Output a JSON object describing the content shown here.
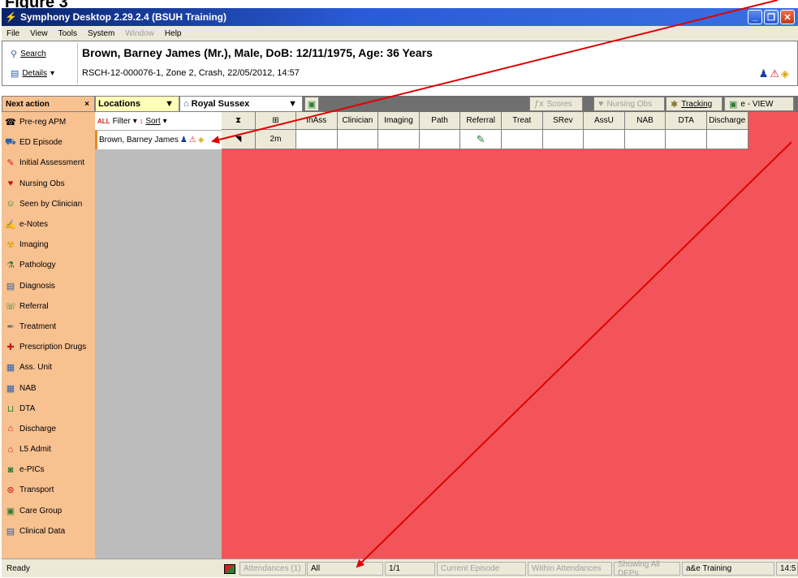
{
  "figure_label": "Figure 3",
  "window": {
    "title": "Symphony Desktop 2.29.2.4 (BSUH Training)",
    "buttons": {
      "minimize": "_",
      "restore": "❐",
      "close": "✕"
    }
  },
  "menu": [
    "File",
    "View",
    "Tools",
    "System",
    "Window",
    "Help"
  ],
  "patient": {
    "search_label": "Search",
    "details_label": "Details",
    "name_line": "Brown, Barney James (Mr.), Male, DoB: 12/11/1975, Age:  36 Years",
    "episode_line": "RSCH-12-000076-1, Zone 2, Crash, 22/05/2012, 14:57"
  },
  "toolbar": {
    "next_action": "Next action",
    "next_action_close": "×",
    "locations": "Locations",
    "site": "Royal Sussex",
    "scores": "Scores",
    "nursing_obs": "Nursing Obs",
    "tracking": "Tracking",
    "eview": "e - VIEW"
  },
  "sidebar": [
    {
      "label": "Pre-reg APM",
      "icon": "phone-icon"
    },
    {
      "label": "ED Episode",
      "icon": "ambulance-icon"
    },
    {
      "label": "Initial Assessment",
      "icon": "assessment-icon"
    },
    {
      "label": "Nursing Obs",
      "icon": "heart-icon"
    },
    {
      "label": "Seen by Clinician",
      "icon": "clinician-icon"
    },
    {
      "label": "e-Notes",
      "icon": "notes-icon"
    },
    {
      "label": "Imaging",
      "icon": "radiation-icon"
    },
    {
      "label": "Pathology",
      "icon": "pathology-icon"
    },
    {
      "label": "Diagnosis",
      "icon": "diagnosis-icon"
    },
    {
      "label": "Referral",
      "icon": "referral-icon"
    },
    {
      "label": "Treatment",
      "icon": "treatment-icon"
    },
    {
      "label": "Prescription Drugs",
      "icon": "drugs-icon"
    },
    {
      "label": "Ass. Unit",
      "icon": "unit-icon"
    },
    {
      "label": "NAB",
      "icon": "unit-icon"
    },
    {
      "label": "DTA",
      "icon": "bed-icon"
    },
    {
      "label": "Discharge",
      "icon": "house-icon"
    },
    {
      "label": "L5 Admit",
      "icon": "house-icon"
    },
    {
      "label": "e-PICs",
      "icon": "camera-icon"
    },
    {
      "label": "Transport",
      "icon": "transport-icon"
    },
    {
      "label": "Care Group",
      "icon": "group-icon"
    },
    {
      "label": "Clinical Data",
      "icon": "data-icon"
    }
  ],
  "list": {
    "all_label": "ALL",
    "filter_label": "Filter",
    "sort_label": "Sort",
    "patient_row": "Brown, Barney James"
  },
  "grid": {
    "headers": [
      "InAss",
      "Clinician",
      "Imaging",
      "Path",
      "Referral",
      "Treat",
      "SRev",
      "AssU",
      "NAB",
      "DTA",
      "Discharge"
    ],
    "time_value": "2m"
  },
  "status": {
    "ready": "Ready",
    "attendances": "Attendances (1)",
    "all": "All",
    "page": "1/1",
    "current_episode": "Current Episode",
    "within_attendances": "Within Attendances",
    "showing_all": "Showing All DEPs",
    "user": "a&e Training",
    "time": "14:5"
  }
}
